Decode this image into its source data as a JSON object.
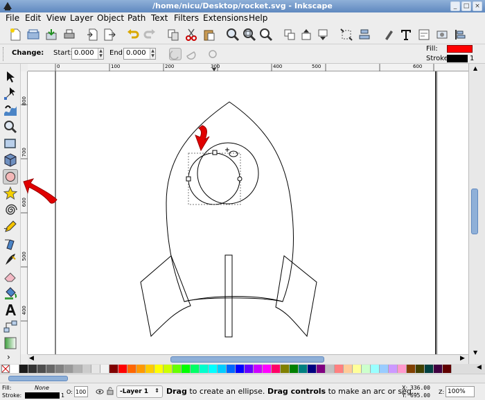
{
  "window": {
    "title": "/home/nicu/Desktop/rocket.svg - Inkscape"
  },
  "menu": [
    "File",
    "Edit",
    "View",
    "Layer",
    "Object",
    "Path",
    "Text",
    "Filters",
    "Extensions",
    "Help"
  ],
  "controls": {
    "change_label": "Change:",
    "start_label": "Start:",
    "start_value": "0.000",
    "end_label": "End:",
    "end_value": "0.000",
    "fill_label": "Fill:",
    "stroke_label": "Stroke:",
    "stroke_width": "1",
    "fill_color": "#ff0000",
    "stroke_color": "#000000"
  },
  "rulers": {
    "h_labels": [
      "0",
      "100",
      "200",
      "300",
      "400",
      "500",
      "600"
    ],
    "v_labels": [
      "800",
      "700",
      "600",
      "500",
      "400",
      "300"
    ]
  },
  "palette": [
    "#ffffff",
    "#1a1a1a",
    "#333333",
    "#4d4d4d",
    "#666666",
    "#808080",
    "#999999",
    "#b3b3b3",
    "#cccccc",
    "#e6e6e6",
    "#f2f2f2",
    "#800000",
    "#ff0000",
    "#ff6600",
    "#ff9900",
    "#ffcc00",
    "#ffff00",
    "#ccff00",
    "#66ff00",
    "#00ff00",
    "#00ff66",
    "#00ffcc",
    "#00ffff",
    "#00ccff",
    "#0066ff",
    "#0000ff",
    "#6600ff",
    "#cc00ff",
    "#ff00ff",
    "#ff0066",
    "#808000",
    "#008000",
    "#008080",
    "#000080",
    "#800080",
    "#c0c0c0",
    "#ff8080",
    "#ffcc99",
    "#ffff99",
    "#ccffcc",
    "#99ffff",
    "#99ccff",
    "#cc99ff",
    "#ff99cc",
    "#804000",
    "#404000",
    "#004040",
    "#400040",
    "#600000"
  ],
  "status": {
    "fill_label": "Fill:",
    "fill_value": "None",
    "stroke_label": "Stroke:",
    "stroke_width": "1",
    "opacity_label": "O:",
    "opacity_value": "100",
    "layer": "-Layer 1",
    "message_bold1": "Drag",
    "message_1": " to create an ellipse. ",
    "message_bold2": "Drag controls",
    "message_2": " to make an arc or seg...",
    "x_label": "X:",
    "x_value": "336.00",
    "y_label": "Y:",
    "y_value": "695.00",
    "zoom_label": "Z:",
    "zoom_value": "100%"
  }
}
